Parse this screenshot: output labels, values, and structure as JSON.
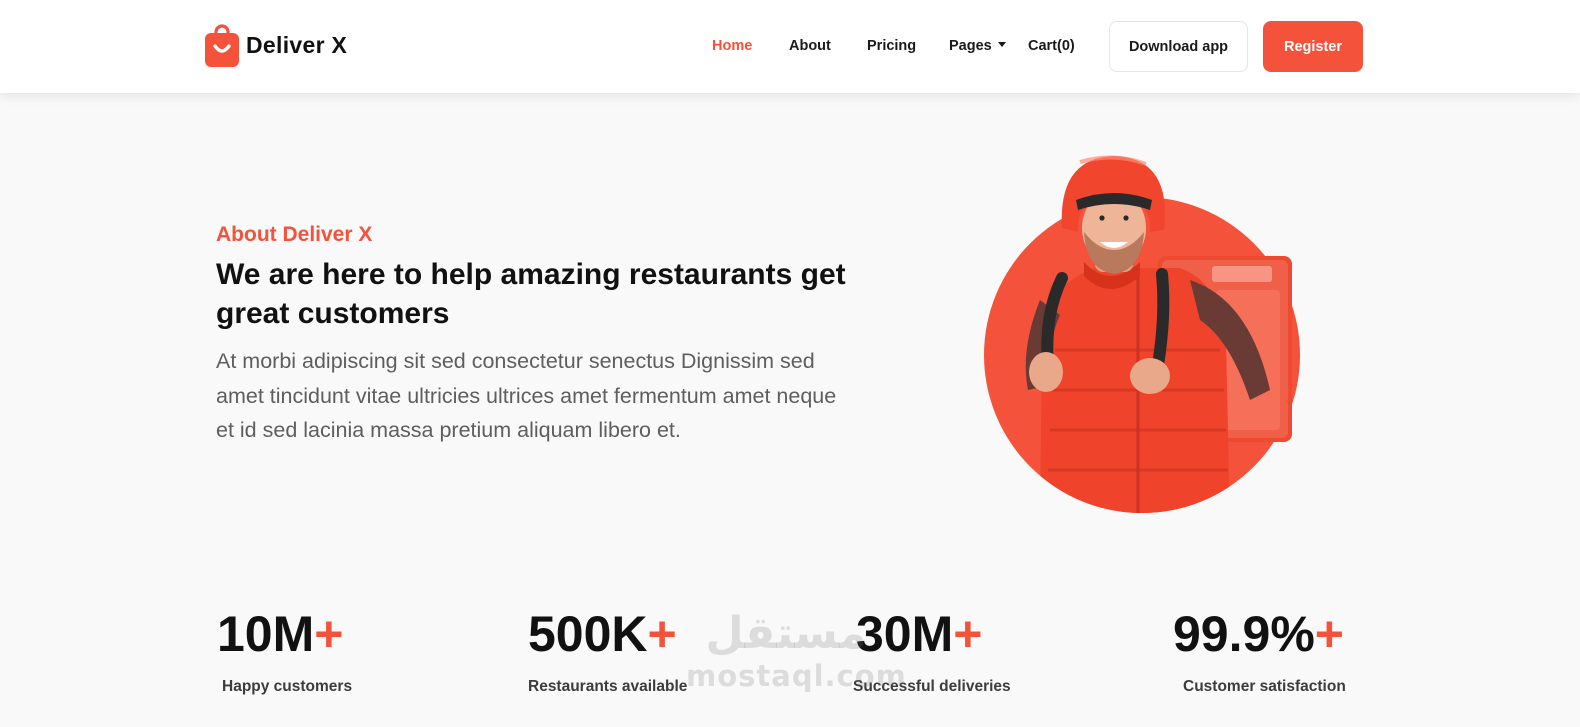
{
  "brand": {
    "name": "Deliver X",
    "accent": "#f4523b"
  },
  "nav": {
    "items": [
      {
        "label": "Home",
        "active": true
      },
      {
        "label": "About"
      },
      {
        "label": "Pricing"
      },
      {
        "label": "Pages",
        "has_dropdown": true
      },
      {
        "label": "Cart(0)"
      }
    ],
    "download_label": "Download app",
    "register_label": "Register"
  },
  "hero": {
    "eyebrow": "About Deliver X",
    "headline": "We are here to help amazing restaurants get great customers",
    "description": "At morbi adipiscing sit sed consectetur senectus Dignissim sed amet tincidunt vitae ultricies ultrices amet fermentum amet neque et id sed lacinia massa pretium aliquam libero et.",
    "image_icon": "delivery-courier-illustration"
  },
  "stats": [
    {
      "value": "10M",
      "suffix": "+",
      "label": "Happy customers"
    },
    {
      "value": "500K",
      "suffix": "+",
      "label": "Restaurants available"
    },
    {
      "value": "30M",
      "suffix": "+",
      "label": "Successful deliveries"
    },
    {
      "value": "99.9%",
      "suffix": "+",
      "label": "Customer satisfaction"
    }
  ],
  "watermark": {
    "arabic": "مستقل",
    "latin": "mostaql.com"
  }
}
